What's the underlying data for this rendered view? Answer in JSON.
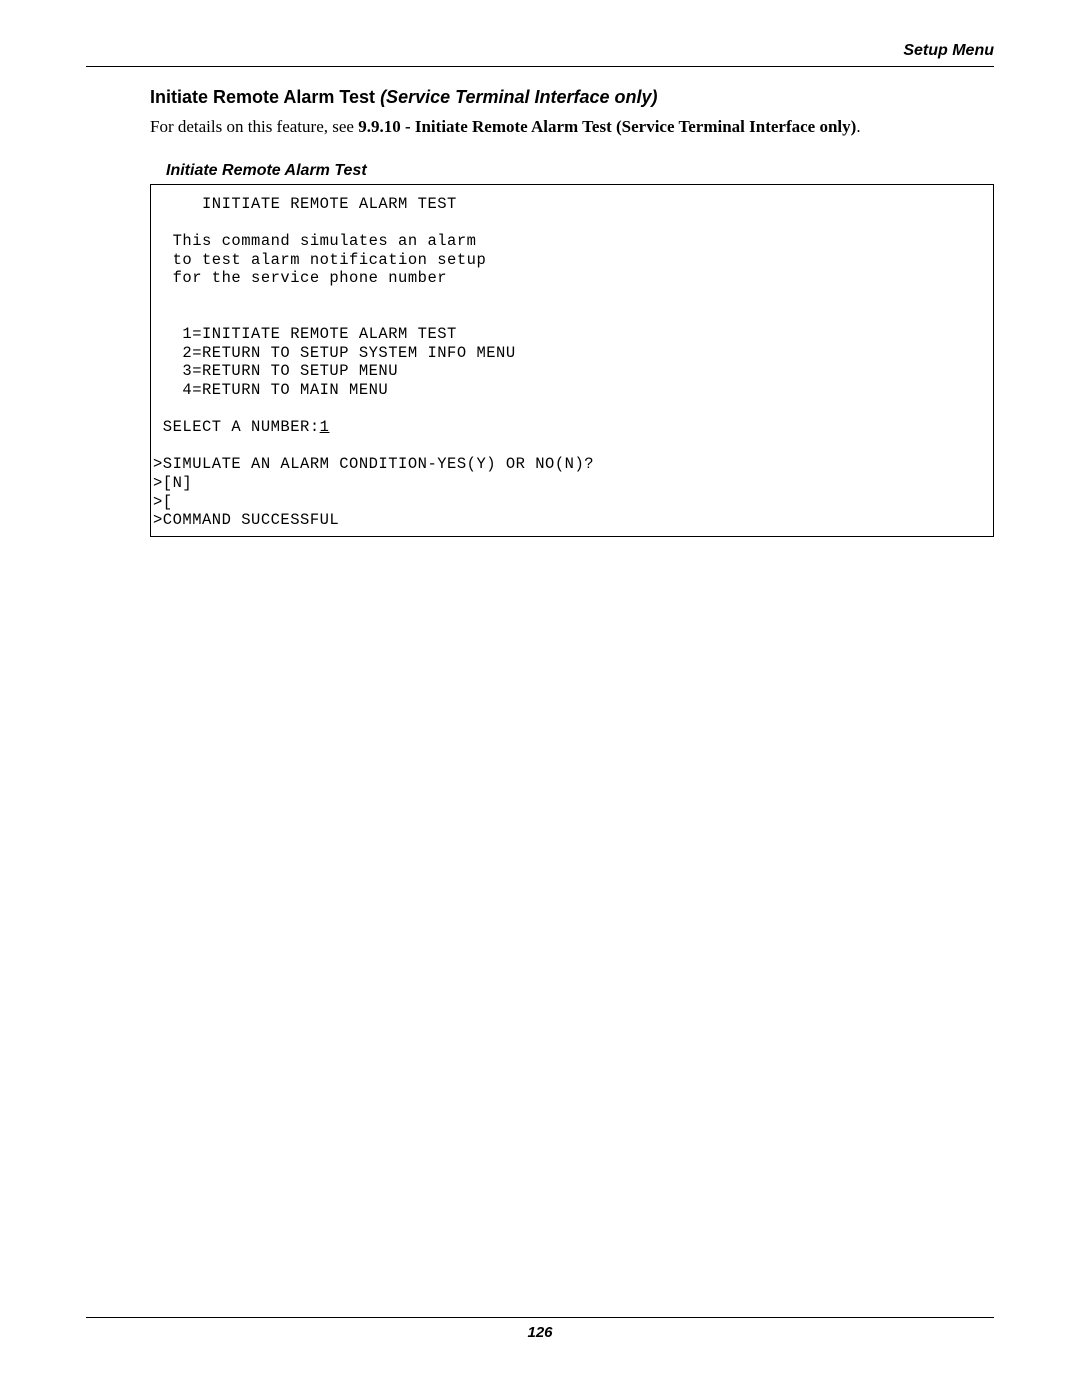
{
  "header": {
    "title": "Setup Menu"
  },
  "section": {
    "title_plain": "Initiate Remote Alarm Test ",
    "title_italic": "(Service Terminal Interface only)",
    "para_lead": "For details on this feature, see ",
    "para_bold": "9.9.10 - Initiate Remote Alarm Test (Service Terminal Interface only)",
    "para_tail": "."
  },
  "box": {
    "title": "Initiate Remote Alarm Test",
    "header": "     INITIATE REMOTE ALARM TEST",
    "desc1": "  This command simulates an alarm",
    "desc2": "  to test alarm notification setup",
    "desc3": "  for the service phone number",
    "opt1": "   1=INITIATE REMOTE ALARM TEST",
    "opt2": "   2=RETURN TO SETUP SYSTEM INFO MENU",
    "opt3": "   3=RETURN TO SETUP MENU",
    "opt4": "   4=RETURN TO MAIN MENU",
    "select_label": " SELECT A NUMBER:",
    "select_value": "1",
    "prompt1": ">SIMULATE AN ALARM CONDITION-YES(Y) OR NO(N)?",
    "prompt2": ">[N]",
    "prompt3": ">[",
    "result": ">COMMAND SUCCESSFUL"
  },
  "footer": {
    "page": "126"
  }
}
